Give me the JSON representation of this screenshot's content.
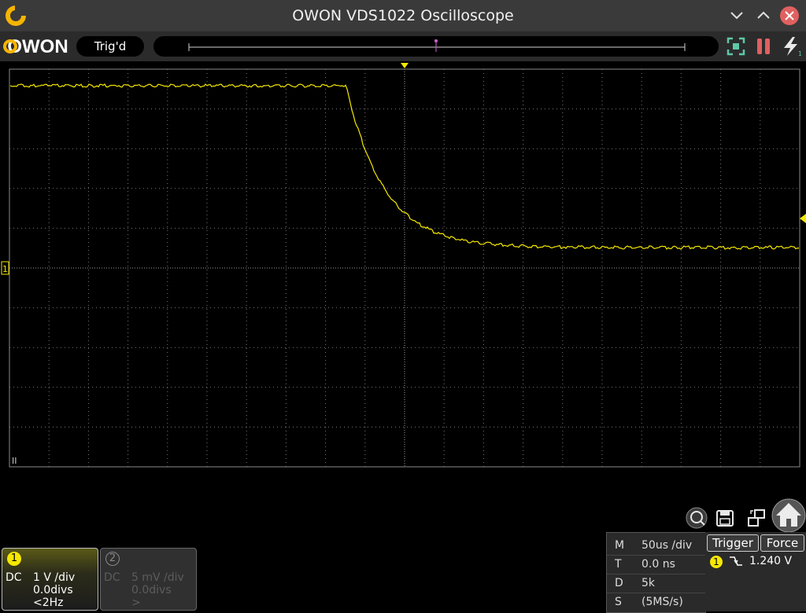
{
  "window": {
    "title": "OWON VDS1022 Oscilloscope"
  },
  "toolbar": {
    "logo_text": "OWON",
    "status": "Trig'd"
  },
  "screen": {
    "ch1_marker": "1",
    "pause_marker": "II"
  },
  "channels": [
    {
      "number": "1",
      "coupling": "DC",
      "volts_per_div": "1 V /div",
      "offset": "0.0divs",
      "freq": "<2Hz",
      "color": "#f5e800",
      "active": true
    },
    {
      "number": "2",
      "coupling": "DC",
      "volts_per_div": "5 mV /div",
      "offset": "0.0divs",
      "freq": ">",
      "color": "#5c5c5c",
      "active": false
    }
  ],
  "acquisition": {
    "m_key": "M",
    "m_val": "50us /div",
    "t_key": "T",
    "t_val": "0.0 ns",
    "d_key": "D",
    "d_val": "5k",
    "s_key": "S",
    "s_val": "(5MS/s)"
  },
  "trigger": {
    "trigger_label": "Trigger",
    "force_label": "Force",
    "source": "1",
    "edge": "falling-edge-icon",
    "level": "1.240 V"
  },
  "icons": [
    "app-logo-icon",
    "minimize-icon",
    "maximize-icon",
    "close-icon",
    "autofit-icon",
    "pause-icon",
    "force-trigger-icon",
    "search-home-icon",
    "save-icon",
    "swap-icon",
    "home-icon"
  ],
  "colors": {
    "trace": "#f5e800",
    "grid": "#7a7a7a",
    "pause": "#e06060",
    "close_button": "#e06060",
    "accent": "#f5c000"
  }
}
